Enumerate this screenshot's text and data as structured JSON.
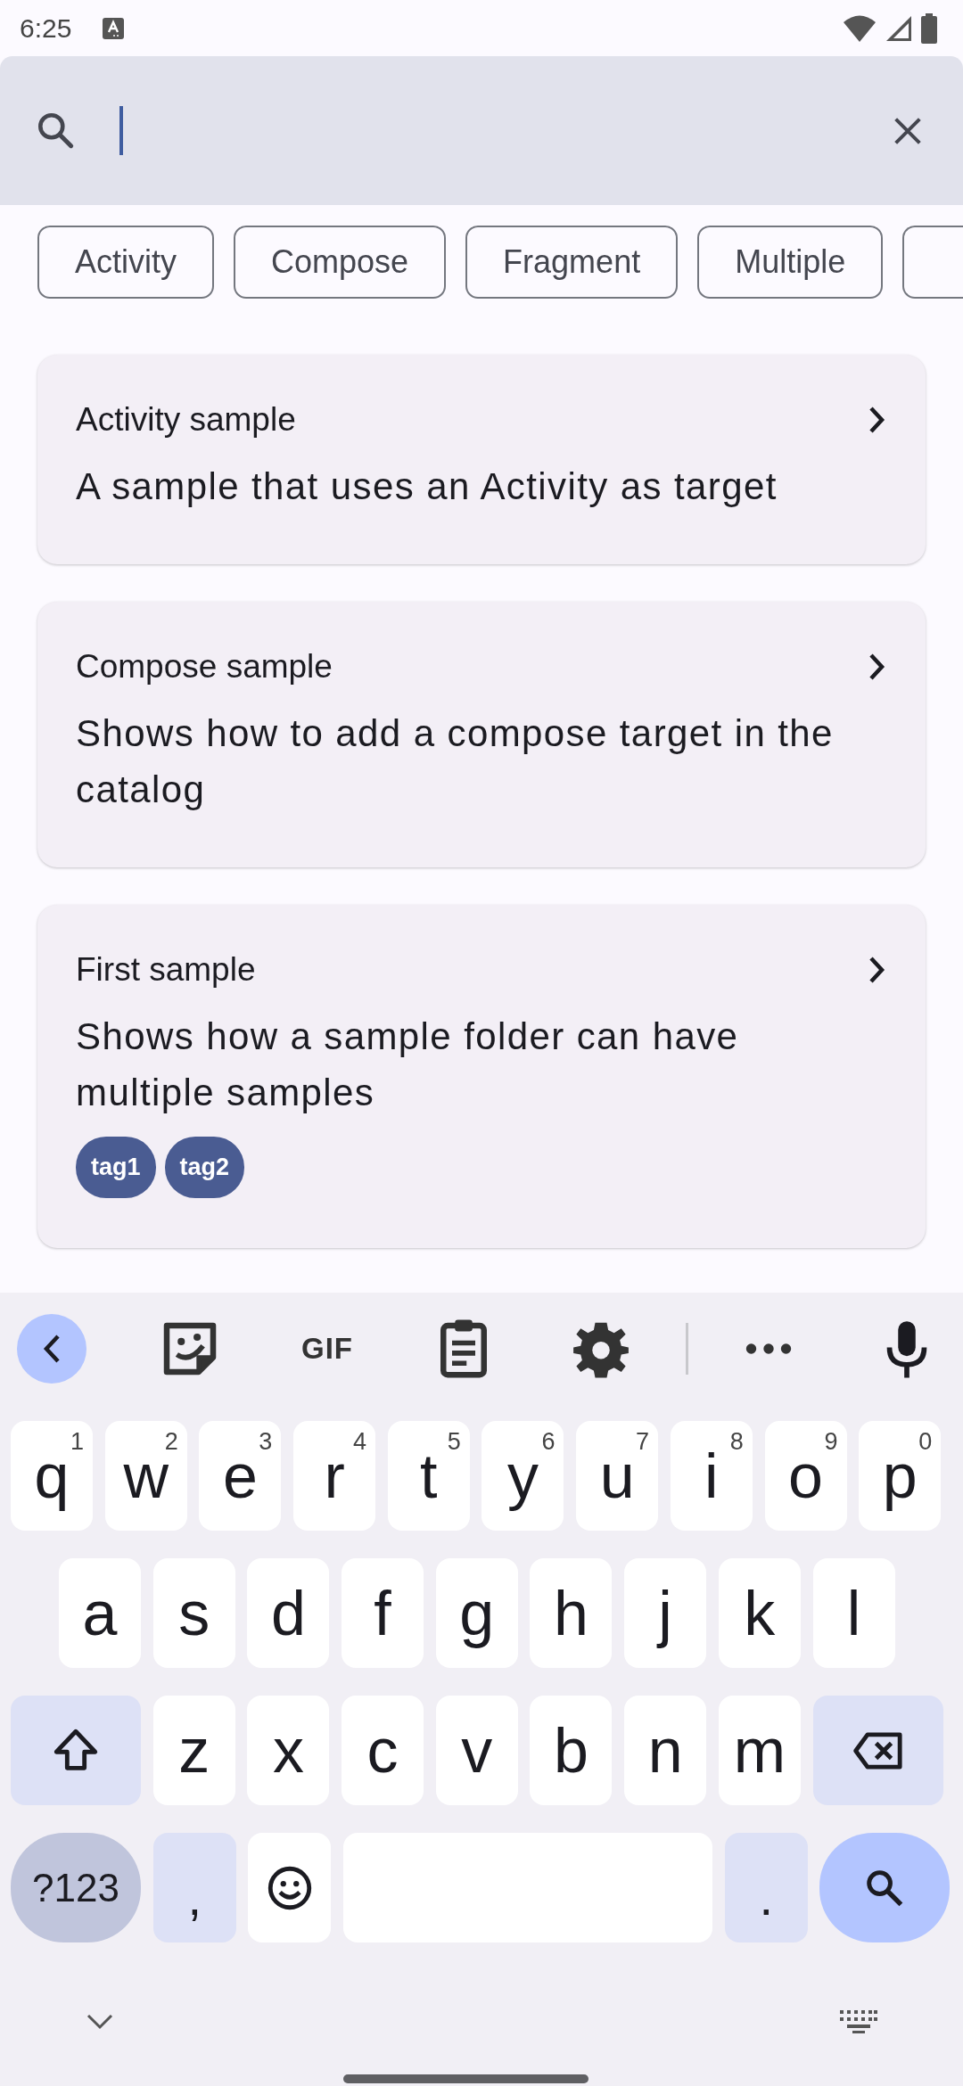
{
  "status_bar": {
    "time": "6:25"
  },
  "search": {
    "focused": true
  },
  "filter_chips": [
    {
      "label": "Activity",
      "selected": false
    },
    {
      "label": "Compose",
      "selected": false
    },
    {
      "label": "Fragment",
      "selected": false
    },
    {
      "label": "Multiple",
      "selected": false
    }
  ],
  "more_chips": true,
  "samples": [
    {
      "title": "Activity sample",
      "description": "A sample that uses an Activity as target"
    },
    {
      "title": "Compose sample",
      "description": "Shows how to add a compose target in the catalog"
    },
    {
      "title": "First sample",
      "description": "Shows how a sample folder can have multiple samples",
      "tags": [
        "tag1",
        "tag2"
      ]
    }
  ],
  "keyboard": {
    "toolbar": {
      "gif": "GIF"
    },
    "rows": [
      {
        "keys": [
          {
            "kind": "char",
            "label": "q",
            "hint": "1"
          },
          {
            "kind": "char",
            "label": "w",
            "hint": "2"
          },
          {
            "kind": "char",
            "label": "e",
            "hint": "3"
          },
          {
            "kind": "char",
            "label": "r",
            "hint": "4"
          },
          {
            "kind": "char",
            "label": "t",
            "hint": "5"
          },
          {
            "kind": "char",
            "label": "y",
            "hint": "6"
          },
          {
            "kind": "char",
            "label": "u",
            "hint": "7"
          },
          {
            "kind": "char",
            "label": "i",
            "hint": "8"
          },
          {
            "kind": "char",
            "label": "o",
            "hint": "9"
          },
          {
            "kind": "char",
            "label": "p",
            "hint": "0"
          }
        ]
      },
      {
        "keys": [
          {
            "kind": "char",
            "label": "a"
          },
          {
            "kind": "char",
            "label": "s"
          },
          {
            "kind": "char",
            "label": "d"
          },
          {
            "kind": "char",
            "label": "f"
          },
          {
            "kind": "char",
            "label": "g"
          },
          {
            "kind": "char",
            "label": "h"
          },
          {
            "kind": "char",
            "label": "j"
          },
          {
            "kind": "char",
            "label": "k"
          },
          {
            "kind": "char",
            "label": "l"
          }
        ]
      },
      {
        "keys": [
          {
            "kind": "shift"
          },
          {
            "kind": "char",
            "label": "z"
          },
          {
            "kind": "char",
            "label": "x"
          },
          {
            "kind": "char",
            "label": "c"
          },
          {
            "kind": "char",
            "label": "v"
          },
          {
            "kind": "char",
            "label": "b"
          },
          {
            "kind": "char",
            "label": "n"
          },
          {
            "kind": "char",
            "label": "m"
          },
          {
            "kind": "backspace"
          }
        ]
      },
      {
        "keys": [
          {
            "kind": "symbols",
            "label": "?123"
          },
          {
            "kind": "punct",
            "label": ","
          },
          {
            "kind": "emoji"
          },
          {
            "kind": "space"
          },
          {
            "kind": "punct",
            "label": "."
          },
          {
            "kind": "action"
          }
        ]
      }
    ]
  }
}
